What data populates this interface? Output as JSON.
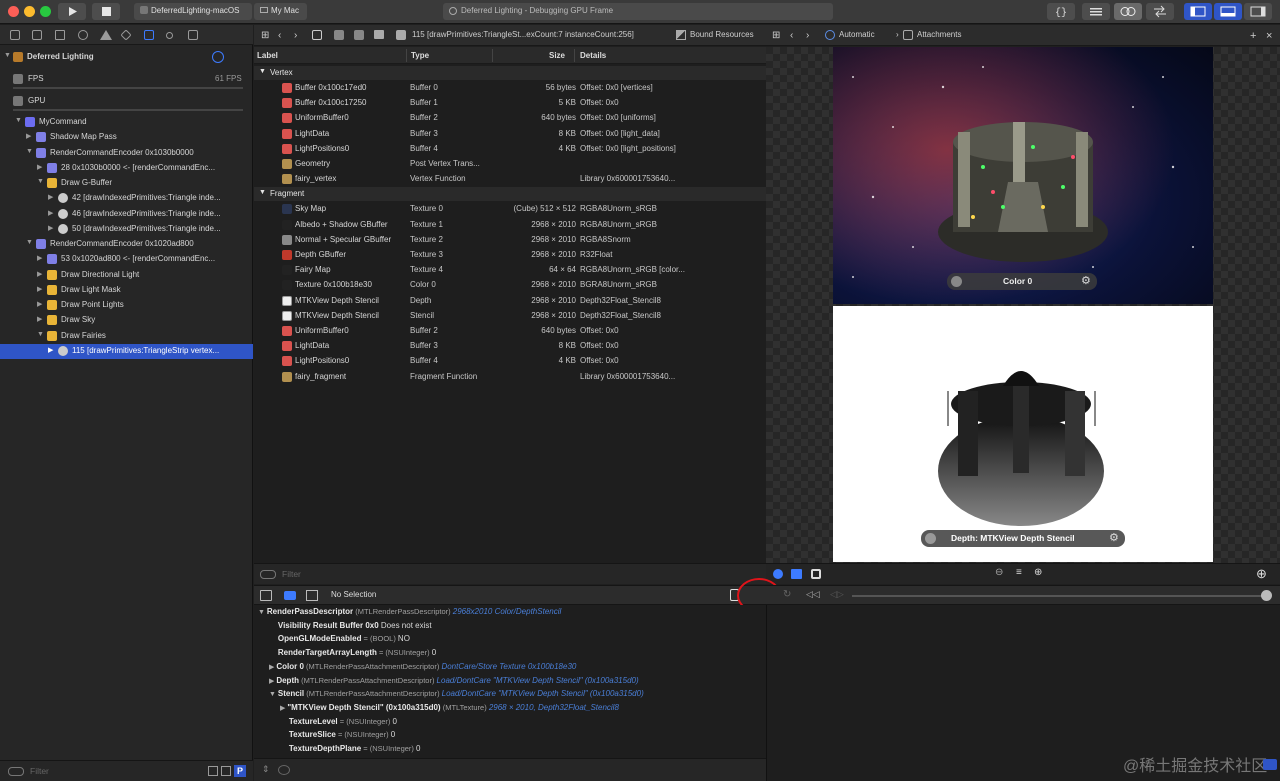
{
  "titlebar": {
    "scheme": "DeferredLighting-macOS",
    "destination": "My Mac",
    "activity": "Deferred Lighting - Debugging GPU Frame"
  },
  "sidebar": {
    "title": "Deferred Lighting",
    "fps_label": "FPS",
    "fps_value": "61 FPS",
    "gpu_label": "GPU",
    "tree": [
      {
        "label": "MyCommand",
        "indent": 0,
        "icon": "command"
      },
      {
        "label": "Shadow Map Pass",
        "indent": 1,
        "icon": "pass"
      },
      {
        "label": "RenderCommandEncoder 0x1030b0000",
        "indent": 1,
        "icon": "encoder"
      },
      {
        "label": "28 0x1030b0000 <- [renderCommandEnc...",
        "indent": 2,
        "icon": "call"
      },
      {
        "label": "Draw G-Buffer",
        "indent": 2,
        "icon": "folder"
      },
      {
        "label": "42 [drawIndexedPrimitives:Triangle inde...",
        "indent": 3,
        "icon": "draw"
      },
      {
        "label": "46 [drawIndexedPrimitives:Triangle inde...",
        "indent": 3,
        "icon": "draw"
      },
      {
        "label": "50 [drawIndexedPrimitives:Triangle inde...",
        "indent": 3,
        "icon": "draw"
      },
      {
        "label": "RenderCommandEncoder 0x1020ad800",
        "indent": 1,
        "icon": "encoder"
      },
      {
        "label": "53 0x1020ad800 <- [renderCommandEnc...",
        "indent": 2,
        "icon": "call"
      },
      {
        "label": "Draw Directional Light",
        "indent": 2,
        "icon": "folder"
      },
      {
        "label": "Draw Light Mask",
        "indent": 2,
        "icon": "folder"
      },
      {
        "label": "Draw Point Lights",
        "indent": 2,
        "icon": "folder"
      },
      {
        "label": "Draw Sky",
        "indent": 2,
        "icon": "folder"
      },
      {
        "label": "Draw Fairies",
        "indent": 2,
        "icon": "folder"
      },
      {
        "label": "115 [drawPrimitives:TriangleStrip vertex...",
        "indent": 3,
        "icon": "draw",
        "selected": true
      }
    ],
    "filter_placeholder": "Filter"
  },
  "center": {
    "breadcrumb_call": "115 [drawPrimitives:TriangleSt...exCount:7 instanceCount:256]",
    "breadcrumb_section": "Bound Resources",
    "columns": [
      "Label",
      "Type",
      "Size",
      "Details"
    ],
    "groups": [
      {
        "name": "Vertex",
        "rows": [
          {
            "label": "Buffer 0x100c17ed0",
            "type": "Buffer 0",
            "size": "56 bytes",
            "details": "Offset: 0x0 [vertices]",
            "icon": "buffer"
          },
          {
            "label": "Buffer 0x100c17250",
            "type": "Buffer 1",
            "size": "5 KB",
            "details": "Offset: 0x0",
            "icon": "buffer"
          },
          {
            "label": "UniformBuffer0",
            "type": "Buffer 2",
            "size": "640 bytes",
            "details": "Offset: 0x0 [uniforms]",
            "icon": "buffer"
          },
          {
            "label": "LightData",
            "type": "Buffer 3",
            "size": "8 KB",
            "details": "Offset: 0x0 [light_data]",
            "icon": "buffer"
          },
          {
            "label": "LightPositions0",
            "type": "Buffer 4",
            "size": "4 KB",
            "details": "Offset: 0x0 [light_positions]",
            "icon": "buffer"
          },
          {
            "label": "Geometry",
            "type": "Post Vertex Trans...",
            "size": "",
            "details": "",
            "icon": "geometry"
          },
          {
            "label": "fairy_vertex",
            "type": "Vertex Function",
            "size": "",
            "details": "Library 0x600001753640...",
            "icon": "function"
          }
        ]
      },
      {
        "name": "Fragment",
        "rows": [
          {
            "label": "Sky Map",
            "type": "Texture 0",
            "size": "(Cube) 512 × 512",
            "details": "RGBA8Unorm_sRGB",
            "icon": "texture-sky"
          },
          {
            "label": "Albedo + Shadow GBuffer",
            "type": "Texture 1",
            "size": "2968 × 2010",
            "details": "RGBA8Unorm_sRGB",
            "icon": "texture-dark"
          },
          {
            "label": "Normal + Specular GBuffer",
            "type": "Texture 2",
            "size": "2968 × 2010",
            "details": "RGBA8Snorm",
            "icon": "texture-gray"
          },
          {
            "label": "Depth GBuffer",
            "type": "Texture 3",
            "size": "2968 × 2010",
            "details": "R32Float",
            "icon": "texture-red"
          },
          {
            "label": "Fairy Map",
            "type": "Texture 4",
            "size": "64 × 64",
            "details": "RGBA8Unorm_sRGB [color...",
            "icon": "texture-dark"
          },
          {
            "label": "Texture 0x100b18e30",
            "type": "Color 0",
            "size": "2968 × 2010",
            "details": "BGRA8Unorm_sRGB",
            "icon": "texture-dark"
          },
          {
            "label": "MTKView Depth Stencil",
            "type": "Depth",
            "size": "2968 × 2010",
            "details": "Depth32Float_Stencil8",
            "icon": "texture-white"
          },
          {
            "label": "MTKView Depth Stencil",
            "type": "Stencil",
            "size": "2968 × 2010",
            "details": "Depth32Float_Stencil8",
            "icon": "texture-white"
          },
          {
            "label": "UniformBuffer0",
            "type": "Buffer 2",
            "size": "640 bytes",
            "details": "Offset: 0x0",
            "icon": "buffer"
          },
          {
            "label": "LightData",
            "type": "Buffer 3",
            "size": "8 KB",
            "details": "Offset: 0x0",
            "icon": "buffer"
          },
          {
            "label": "LightPositions0",
            "type": "Buffer 4",
            "size": "4 KB",
            "details": "Offset: 0x0",
            "icon": "buffer"
          },
          {
            "label": "fairy_fragment",
            "type": "Fragment Function",
            "size": "",
            "details": "Library 0x600001753640...",
            "icon": "function"
          }
        ]
      }
    ],
    "filter_placeholder": "Filter"
  },
  "viewer": {
    "mode": "Automatic",
    "section": "Attachments",
    "color_caption": "Color 0",
    "depth_caption": "Depth: MTKView Depth Stencil"
  },
  "debug": {
    "selection": "No Selection",
    "variables": [
      {
        "indent": 0,
        "disclosure": "open",
        "name": "RenderPassDescriptor",
        "type": "(MTLRenderPassDescriptor)",
        "value": "",
        "link": "2968x2010 Color/DepthStencil"
      },
      {
        "indent": 1,
        "disclosure": "",
        "name": "Visibility Result Buffer 0x0",
        "type": "",
        "value": "Does not exist",
        "link": ""
      },
      {
        "indent": 1,
        "disclosure": "",
        "name": "OpenGLModeEnabled",
        "type": "= (BOOL)",
        "value": "NO",
        "link": ""
      },
      {
        "indent": 1,
        "disclosure": "",
        "name": "RenderTargetArrayLength",
        "type": "= (NSUInteger)",
        "value": "0",
        "link": ""
      },
      {
        "indent": 1,
        "disclosure": "closed",
        "name": "Color 0",
        "type": "(MTLRenderPassAttachmentDescriptor)",
        "value": "",
        "link": "DontCare/Store Texture 0x100b18e30"
      },
      {
        "indent": 1,
        "disclosure": "closed",
        "name": "Depth",
        "type": "(MTLRenderPassAttachmentDescriptor)",
        "value": "",
        "link": "Load/DontCare \"MTKView Depth Stencil\" (0x100a315d0)"
      },
      {
        "indent": 1,
        "disclosure": "open",
        "name": "Stencil",
        "type": "(MTLRenderPassAttachmentDescriptor)",
        "value": "",
        "link": "Load/DontCare \"MTKView Depth Stencil\" (0x100a315d0)"
      },
      {
        "indent": 2,
        "disclosure": "closed",
        "name": "\"MTKView Depth Stencil\" (0x100a315d0)",
        "type": "(MTLTexture)",
        "value": "",
        "link": "2968 × 2010, Depth32Float_Stencil8"
      },
      {
        "indent": 2,
        "disclosure": "",
        "name": "TextureLevel",
        "type": "= (NSUInteger)",
        "value": "0",
        "link": ""
      },
      {
        "indent": 2,
        "disclosure": "",
        "name": "TextureSlice",
        "type": "= (NSUInteger)",
        "value": "0",
        "link": ""
      },
      {
        "indent": 2,
        "disclosure": "",
        "name": "TextureDepthPlane",
        "type": "= (NSUInteger)",
        "value": "0",
        "link": ""
      }
    ]
  },
  "watermark": "@稀土掘金技术社区"
}
